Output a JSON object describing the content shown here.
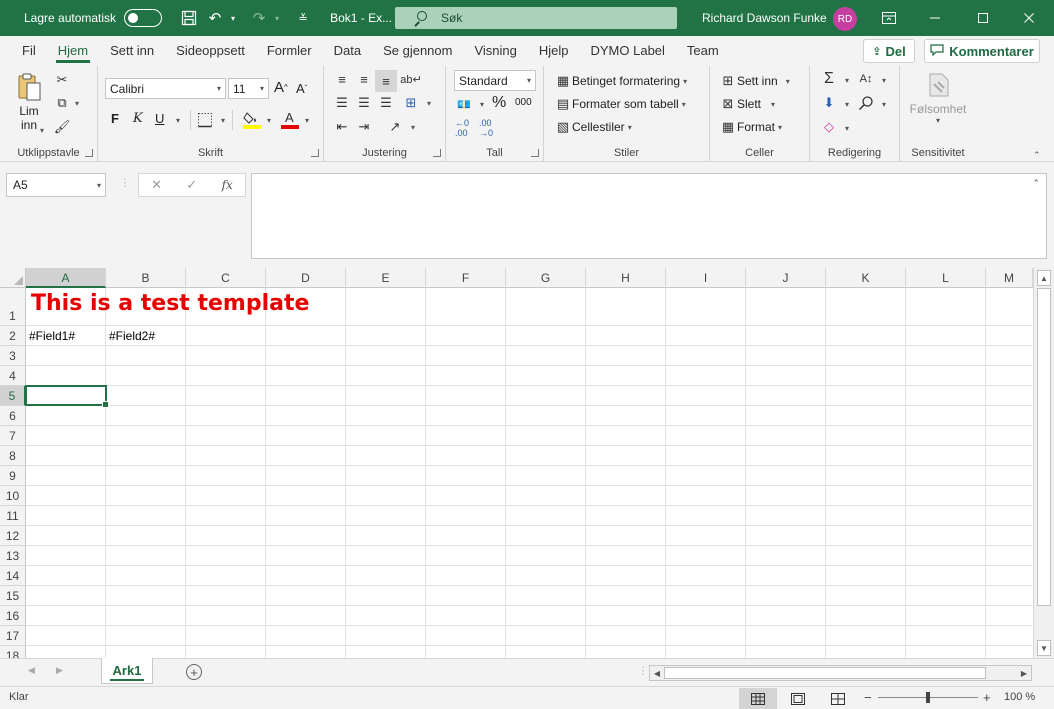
{
  "titlebar": {
    "autosave_label": "Lagre automatisk",
    "doc_title": "Bok1  -  Ex...",
    "search_placeholder": "Søk",
    "user_name": "Richard Dawson Funke",
    "user_initials": "RD",
    "accent_color": "#217346"
  },
  "tabs": [
    {
      "label": "Fil"
    },
    {
      "label": "Hjem"
    },
    {
      "label": "Sett inn"
    },
    {
      "label": "Sideoppsett"
    },
    {
      "label": "Formler"
    },
    {
      "label": "Data"
    },
    {
      "label": "Se gjennom"
    },
    {
      "label": "Visning"
    },
    {
      "label": "Hjelp"
    },
    {
      "label": "DYMO Label"
    },
    {
      "label": "Team"
    }
  ],
  "share_label": "Del",
  "comment_label": "Kommentarer",
  "ribbon": {
    "clipboard": {
      "label": "Utklippstavle",
      "paste_line1": "Lim",
      "paste_line2": "inn"
    },
    "font": {
      "label": "Skrift",
      "font_name": "Calibri",
      "font_size": "11",
      "bold": "F",
      "italic": "K",
      "underline": "U"
    },
    "alignment": {
      "label": "Justering"
    },
    "number": {
      "label": "Tall",
      "format": "Standard"
    },
    "styles": {
      "label": "Stiler",
      "conditional": "Betinget formatering",
      "format_table": "Formater som tabell",
      "cell_styles": "Cellestiler"
    },
    "cells": {
      "label": "Celler",
      "insert": "Sett inn",
      "delete": "Slett",
      "format": "Format"
    },
    "editing": {
      "label": "Redigering"
    },
    "sensitivity": {
      "label": "Sensitivitet",
      "button": "Følsomhet"
    }
  },
  "formula": {
    "name_box": "A5",
    "fx": "fx",
    "value": ""
  },
  "grid": {
    "columns": [
      "A",
      "B",
      "C",
      "D",
      "E",
      "F",
      "G",
      "H",
      "I",
      "J",
      "K",
      "L",
      "M"
    ],
    "rows": [
      "1",
      "2",
      "3",
      "4",
      "5",
      "6",
      "7",
      "8",
      "9",
      "10",
      "11",
      "12",
      "13",
      "14",
      "15",
      "16",
      "17",
      "18"
    ],
    "selected_col": "A",
    "selected_row": "5",
    "a1": "This is a test template",
    "a1_color": "#e60000",
    "a2": "#Field1#",
    "b2": "#Field2#"
  },
  "sheets": [
    {
      "label": "Ark1"
    }
  ],
  "status": {
    "text": "Klar",
    "zoom": "100 %"
  }
}
